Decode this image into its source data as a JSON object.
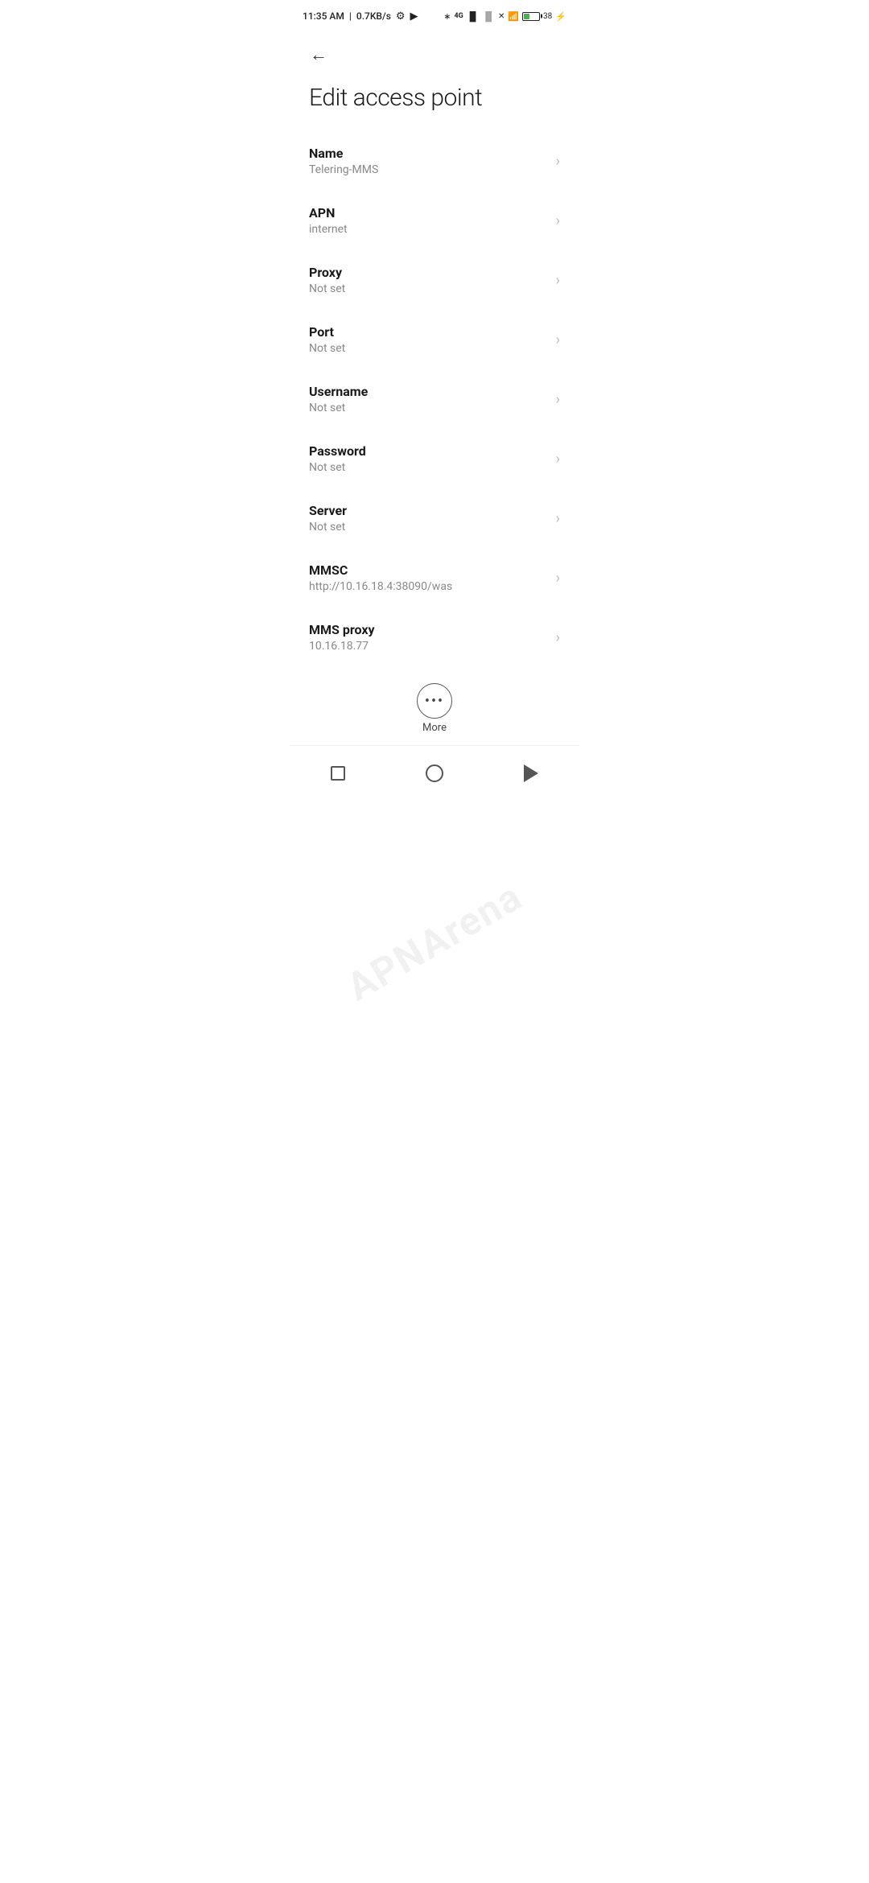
{
  "statusBar": {
    "time": "11:35 AM",
    "speed": "0.7KB/s"
  },
  "header": {
    "title": "Edit access point"
  },
  "settings": [
    {
      "label": "Name",
      "value": "Telering-MMS"
    },
    {
      "label": "APN",
      "value": "internet"
    },
    {
      "label": "Proxy",
      "value": "Not set"
    },
    {
      "label": "Port",
      "value": "Not set"
    },
    {
      "label": "Username",
      "value": "Not set"
    },
    {
      "label": "Password",
      "value": "Not set"
    },
    {
      "label": "Server",
      "value": "Not set"
    },
    {
      "label": "MMSC",
      "value": "http://10.16.18.4:38090/was"
    },
    {
      "label": "MMS proxy",
      "value": "10.16.18.77"
    }
  ],
  "more": {
    "label": "More"
  },
  "watermark": "APNArena"
}
